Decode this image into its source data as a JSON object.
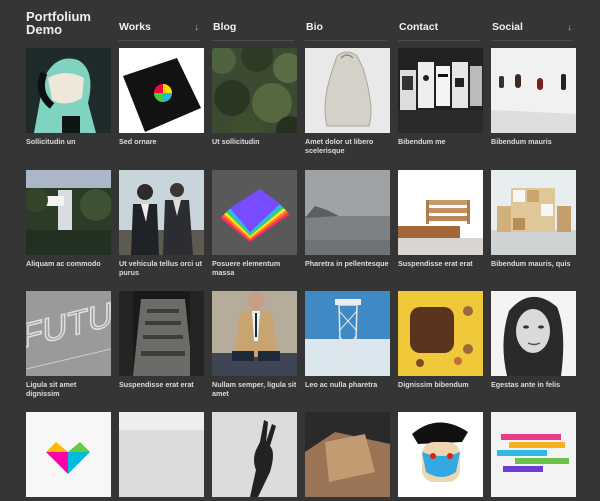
{
  "header": {
    "logo_line1": "Portfolium",
    "logo_line2": "Demo"
  },
  "nav": [
    {
      "label": "Works",
      "has_dropdown": true,
      "icon": "arrow-down-icon"
    },
    {
      "label": "Blog",
      "has_dropdown": false
    },
    {
      "label": "Bio",
      "has_dropdown": false
    },
    {
      "label": "Contact",
      "has_dropdown": false
    },
    {
      "label": "Social",
      "has_dropdown": true,
      "icon": "arrow-down-icon"
    }
  ],
  "items": [
    {
      "title": "Sollicitudin un",
      "thumb": "portrait-teal"
    },
    {
      "title": "Sed ornare",
      "thumb": "color-wheel-book"
    },
    {
      "title": "Ut sollicitudin",
      "thumb": "forest-aerial"
    },
    {
      "title": "Amet dolor ut libero scelerisque",
      "thumb": "tote-bag"
    },
    {
      "title": "Bibendum me",
      "thumb": "brochures"
    },
    {
      "title": "Bibendum mauris",
      "thumb": "gallery-room"
    },
    {
      "title": "Aliquam ac commodo",
      "thumb": "waterfall-house"
    },
    {
      "title": "Ut vehicula tellus orci ut purus",
      "thumb": "suited-men"
    },
    {
      "title": "Posuere elementum massa",
      "thumb": "rainbow-book"
    },
    {
      "title": "Pharetra in pellentesque",
      "thumb": "misty-coast"
    },
    {
      "title": "Suspendisse erat erat",
      "thumb": "wood-shelf"
    },
    {
      "title": "Bibendum mauris, quis",
      "thumb": "room-shelving"
    },
    {
      "title": "Ligula sit amet dignissim",
      "thumb": "futu-typography"
    },
    {
      "title": "Suspendisse erat erat",
      "thumb": "stairs"
    },
    {
      "title": "Nullam semper, ligula sit amet",
      "thumb": "man-in-suit"
    },
    {
      "title": "Leo ac nulla pharetra",
      "thumb": "tower"
    },
    {
      "title": "Dignissim bibendum",
      "thumb": "chocolate-yellow"
    },
    {
      "title": "Egestas ante in felis",
      "thumb": "woman-portrait"
    },
    {
      "title": "",
      "thumb": "colorful-logo"
    },
    {
      "title": "",
      "thumb": "grey-panel"
    },
    {
      "title": "",
      "thumb": "hand-silhouette"
    },
    {
      "title": "",
      "thumb": "wood-sculpture"
    },
    {
      "title": "",
      "thumb": "captain-illustration"
    },
    {
      "title": "",
      "thumb": "color-stripes"
    }
  ]
}
